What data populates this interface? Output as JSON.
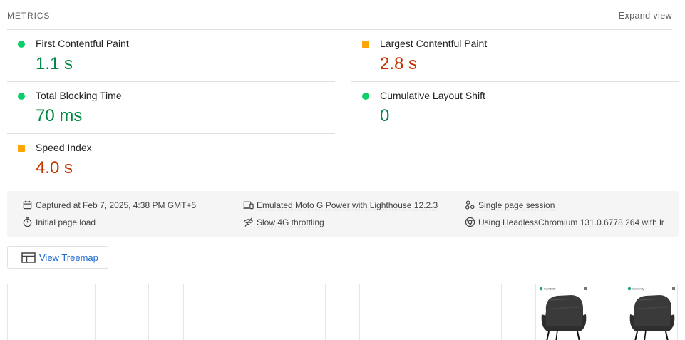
{
  "header": {
    "title": "METRICS",
    "expand_label": "Expand view"
  },
  "metrics": [
    {
      "label": "First Contentful Paint",
      "value": "1.1 s",
      "status": "pass"
    },
    {
      "label": "Largest Contentful Paint",
      "value": "2.8 s",
      "status": "average"
    },
    {
      "label": "Total Blocking Time",
      "value": "70 ms",
      "status": "pass"
    },
    {
      "label": "Cumulative Layout Shift",
      "value": "0",
      "status": "pass"
    },
    {
      "label": "Speed Index",
      "value": "4.0 s",
      "status": "average"
    }
  ],
  "meta": {
    "captured": "Captured at Feb 7, 2025, 4:38 PM GMT+5",
    "device": "Emulated Moto G Power with Lighthouse 12.2.3",
    "session": "Single page session",
    "load": "Initial page load",
    "throttling": "Slow 4G throttling",
    "browser": "Using HeadlessChromium 131.0.6778.264 with lr"
  },
  "treemap": {
    "label": "View Treemap"
  },
  "filmstrip": {
    "brand": "Comfinity"
  },
  "colors": {
    "pass": "#0cce6b",
    "pass_text": "#018642",
    "average": "#ffa400",
    "average_text": "#c33300",
    "link": "#1967d2"
  }
}
